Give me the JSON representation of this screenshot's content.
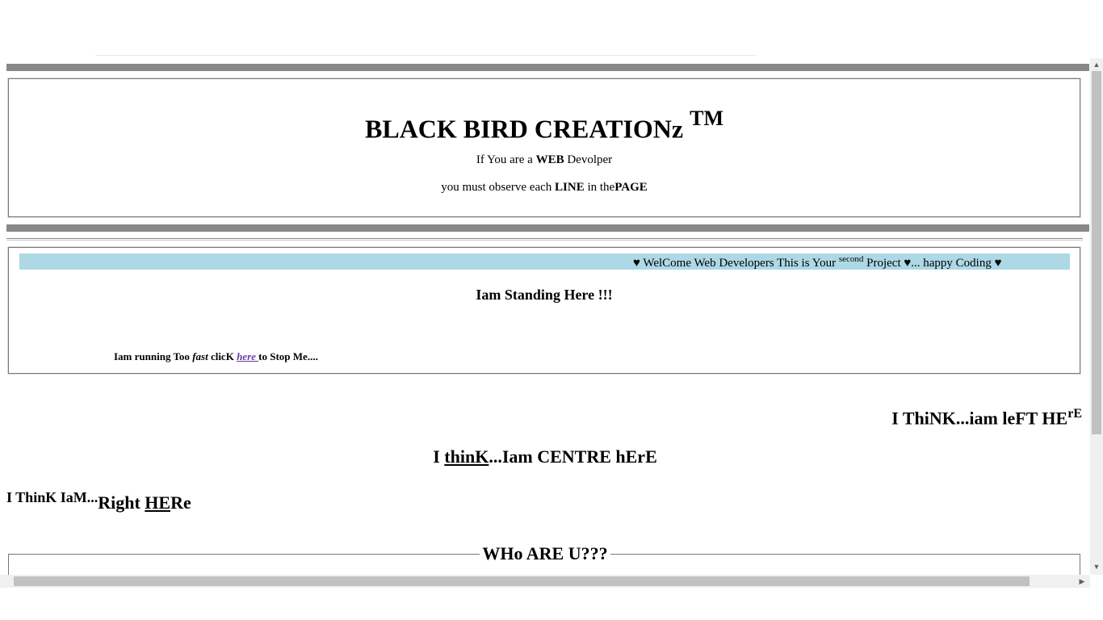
{
  "header": {
    "title": "BLACK BIRD CREATIONz ",
    "trademark": "TM",
    "line1_a": "If You are a ",
    "line1_b": "WEB",
    "line1_c": " Devolper",
    "line2_a": "you must observe each ",
    "line2_b": "LINE",
    "line2_c": " in the",
    "line2_d": "PAGE"
  },
  "marquee": {
    "text_a": "♥ WelCome Web Developers This is Your ",
    "text_sup": "second",
    "text_b": " Project ♥... happy Coding ♥",
    "bg": "#add8e6"
  },
  "standing": "Iam Standing Here !!!",
  "running": {
    "a": "Iam running Too ",
    "b": "fast",
    "c": " clicK ",
    "link": "here ",
    "d": "to Stop Me...."
  },
  "left_here": {
    "text": "I ThiNK...iam leFT HE",
    "sup": "rE"
  },
  "centre_here": {
    "a": "I ",
    "b": "thinK",
    "c": "...Iam CENTRE hErE"
  },
  "right_here": {
    "small": "I ThinK IaM...",
    "a": "Right ",
    "b": "HE",
    "c": "Re"
  },
  "who": "WHo ARE U???",
  "scrollbar": {
    "up_icon": "▲",
    "down_icon": "▼",
    "right_icon": "▶"
  }
}
